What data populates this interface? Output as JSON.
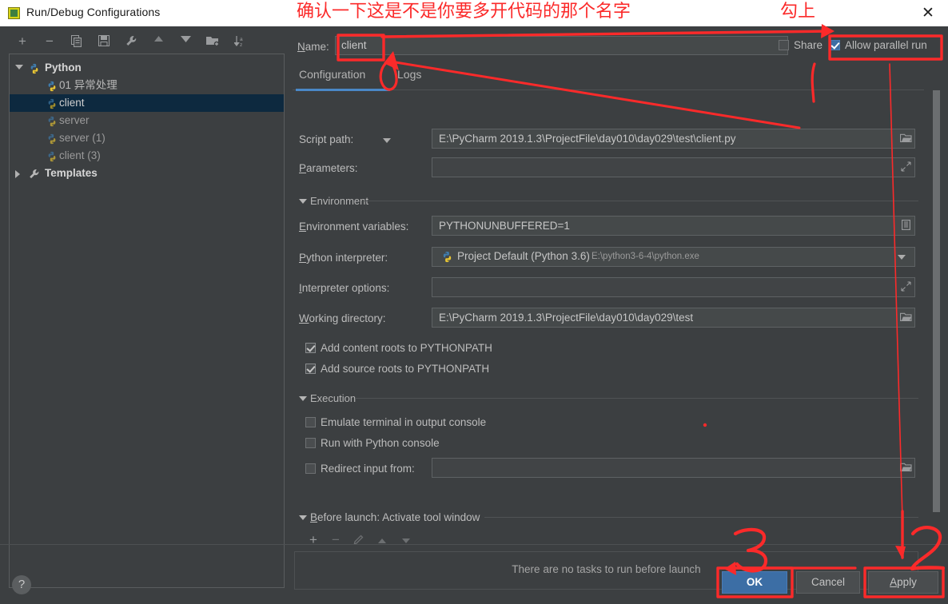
{
  "window": {
    "title": "Run/Debug Configurations",
    "icon": "pycharm-icon",
    "close_label": "✕"
  },
  "annotations": {
    "note_top": "确认一下这是不是你要多开代码的那个名字",
    "note_check": "勾上",
    "step_3": "3",
    "step_2": "2",
    "color": "#fb2a2a"
  },
  "sidebar": {
    "toolbar": [
      {
        "name": "add-configuration",
        "glyph": "+"
      },
      {
        "name": "remove-configuration",
        "glyph": "−"
      },
      {
        "name": "copy-configuration",
        "glyph": "copy-icon"
      },
      {
        "name": "save-configuration",
        "glyph": "save-icon"
      },
      {
        "name": "edit-templates",
        "glyph": "wrench-icon"
      },
      {
        "name": "move-up",
        "glyph": "triangle-up-icon"
      },
      {
        "name": "move-down",
        "glyph": "triangle-down-icon"
      },
      {
        "name": "new-folder",
        "glyph": "folder-add-icon"
      },
      {
        "name": "sort-alphabetically",
        "glyph": "sort-az-icon"
      }
    ],
    "tree": [
      {
        "label": "Python",
        "level": 0,
        "expanded": true,
        "icon": "python-icon",
        "selected": false,
        "bold": true
      },
      {
        "label": "01 异常处理",
        "level": 1,
        "icon": "python-icon",
        "selected": false,
        "bold": false
      },
      {
        "label": "client",
        "level": 1,
        "icon": "python-icon",
        "selected": true,
        "bold": false
      },
      {
        "label": "server",
        "level": 1,
        "icon": "python-icon",
        "selected": false,
        "bold": false,
        "dim": true
      },
      {
        "label": "server (1)",
        "level": 1,
        "icon": "python-icon",
        "selected": false,
        "bold": false,
        "dim": true
      },
      {
        "label": "client (3)",
        "level": 1,
        "icon": "python-icon",
        "selected": false,
        "bold": false,
        "dim": true
      },
      {
        "label": "Templates",
        "level": 0,
        "expanded": false,
        "icon": "wrench-icon",
        "selected": false,
        "bold": true
      }
    ],
    "help_label": "?"
  },
  "main": {
    "name_label": "Name:",
    "name_value": "client",
    "share_label": "Share",
    "share_checked": false,
    "parallel_label": "Allow parallel run",
    "parallel_checked": true,
    "tabs": [
      {
        "label": "Configuration",
        "active": true
      },
      {
        "label": "Logs",
        "active": false
      }
    ],
    "fields": [
      {
        "name": "script-path",
        "label": "Script path:",
        "value": "E:\\PyCharm 2019.1.3\\ProjectFile\\day010\\day029\\test\\client.py",
        "trailing_icon": "folder-icon",
        "has_combo": true
      },
      {
        "name": "parameters",
        "label": "Parameters:",
        "value": "",
        "trailing_icon": "expand-icon",
        "has_combo": false
      },
      {
        "name": "environment-variables",
        "label": "Environment variables:",
        "value": "PYTHONUNBUFFERED=1",
        "trailing_icon": "list-icon",
        "has_combo": false
      },
      {
        "name": "interpreter-options",
        "label": "Interpreter options:",
        "value": "",
        "trailing_icon": "expand-icon",
        "has_combo": false
      },
      {
        "name": "working-directory",
        "label": "Working directory:",
        "value": "E:\\PyCharm 2019.1.3\\ProjectFile\\day010\\day029\\test",
        "trailing_icon": "folder-icon",
        "has_combo": false
      }
    ],
    "interpreter": {
      "label": "Python interpreter:",
      "value": "Project Default (Python 3.6)",
      "path": "E:\\python3-6-4\\python.exe",
      "icon": "python-icon"
    },
    "sections": [
      {
        "name": "environment",
        "label": "Environment",
        "expanded": true
      },
      {
        "name": "execution",
        "label": "Execution",
        "expanded": true
      }
    ],
    "checkboxes": [
      {
        "name": "add-content-roots",
        "label": "Add content roots to PYTHONPATH",
        "checked": true
      },
      {
        "name": "add-source-roots",
        "label": "Add source roots to PYTHONPATH",
        "checked": true
      },
      {
        "name": "emulate-terminal",
        "label": "Emulate terminal in output console",
        "checked": false
      },
      {
        "name": "run-with-python-console",
        "label": "Run with Python console",
        "checked": false
      },
      {
        "name": "redirect-input-from",
        "label": "Redirect input from:",
        "checked": false
      }
    ],
    "redirect_input_value": "",
    "before_launch": {
      "title": "Before launch: Activate tool window",
      "empty_text": "There are no tasks to run before launch",
      "toolbar": [
        {
          "name": "add-task",
          "glyph": "+",
          "disabled": false
        },
        {
          "name": "remove-task",
          "glyph": "−",
          "disabled": true
        },
        {
          "name": "edit-task",
          "glyph": "pencil-icon",
          "disabled": true
        },
        {
          "name": "move-task-up",
          "glyph": "triangle-up-icon",
          "disabled": true
        },
        {
          "name": "move-task-down",
          "glyph": "triangle-down-icon",
          "disabled": true
        }
      ]
    }
  },
  "footer": {
    "ok_label": "OK",
    "cancel_label": "Cancel",
    "apply_label": "Apply"
  },
  "colors": {
    "window_bg": "#3c3f41",
    "titlebar_bg": "#ffffff",
    "accent_blue": "#4a88c7",
    "selection_bg": "#0d293f",
    "annotation_red": "#fb2a2a",
    "ok_button_bg": "#3c6ea5"
  }
}
